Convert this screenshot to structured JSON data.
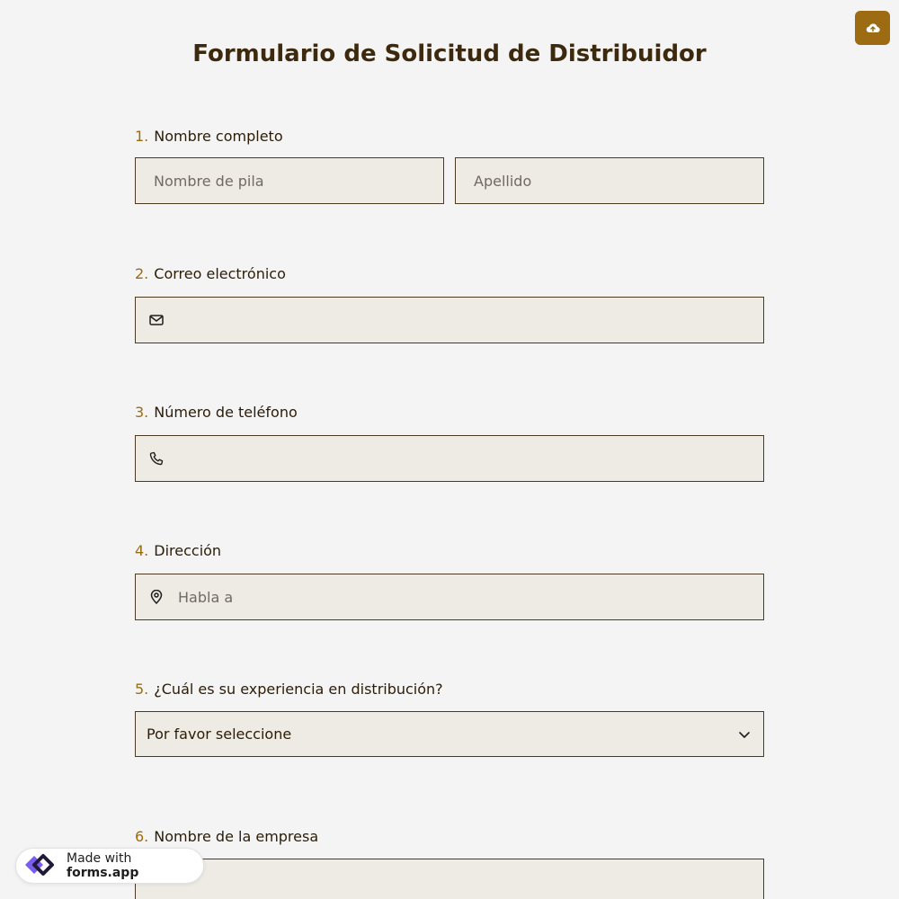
{
  "header": {
    "title": "Formulario de Solicitud de Distribuidor",
    "upload_icon": "cloud-upload-icon",
    "accent_color": "#9c6b12"
  },
  "questions": [
    {
      "number": "1.",
      "label": "Nombre completo",
      "fields": [
        {
          "placeholder": "Nombre de pila"
        },
        {
          "placeholder": "Apellido"
        }
      ]
    },
    {
      "number": "2.",
      "label": "Correo electrónico",
      "icon": "envelope-icon",
      "placeholder": ""
    },
    {
      "number": "3.",
      "label": "Número de teléfono",
      "icon": "phone-icon",
      "placeholder": ""
    },
    {
      "number": "4.",
      "label": "Dirección",
      "icon": "map-pin-icon",
      "placeholder": "Habla a"
    },
    {
      "number": "5.",
      "label": "¿Cuál es su experiencia en distribución?",
      "selected": "Por favor seleccione",
      "icon": "chevron-down-icon"
    },
    {
      "number": "6.",
      "label": "Nombre de la empresa",
      "placeholder": ""
    }
  ],
  "badge": {
    "prefix": "Made with",
    "brand": "forms.app",
    "icon": "forms-app-logo-icon"
  }
}
